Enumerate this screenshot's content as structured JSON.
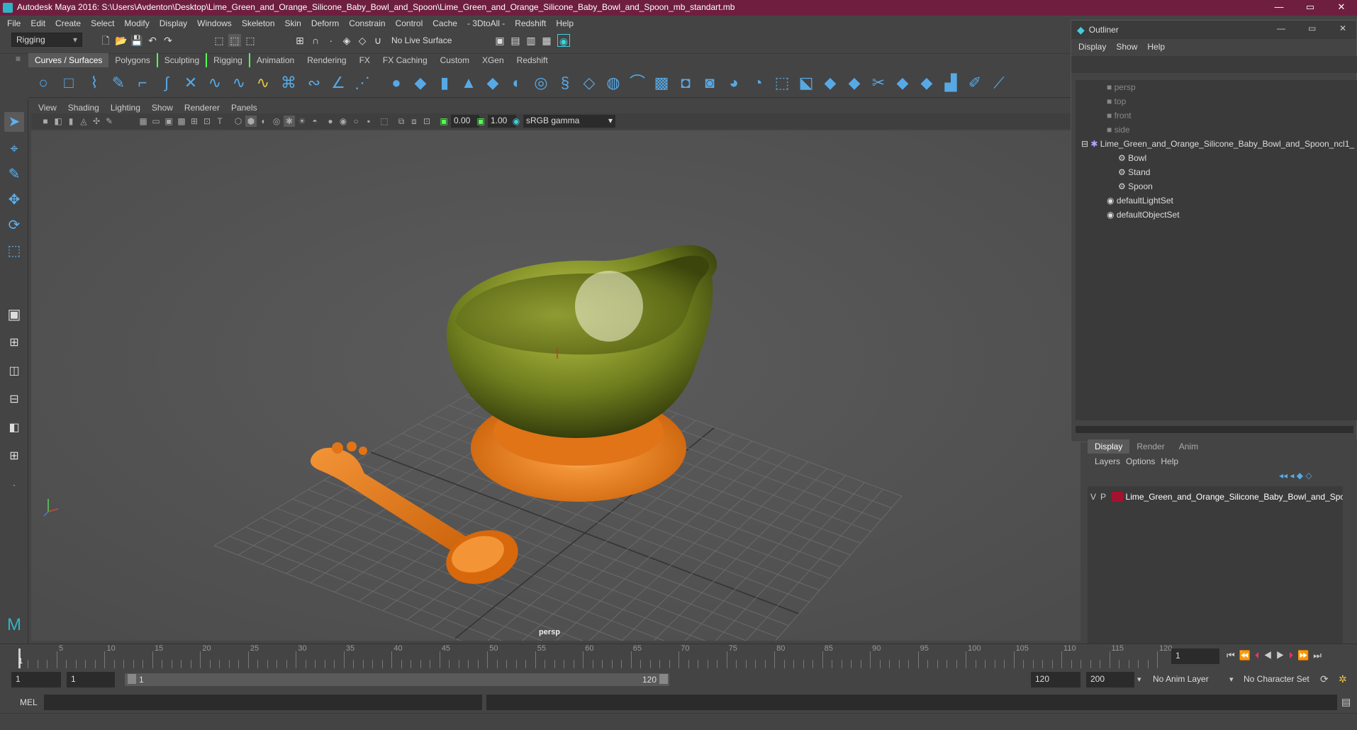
{
  "window": {
    "title": "Autodesk Maya 2016: S:\\Users\\Avdenton\\Desktop\\Lime_Green_and_Orange_Silicone_Baby_Bowl_and_Spoon\\Lime_Green_and_Orange_Silicone_Baby_Bowl_and_Spoon_mb_standart.mb",
    "minimize": "—",
    "maximize": "▭",
    "close": "✕"
  },
  "menubar": [
    "File",
    "Edit",
    "Create",
    "Select",
    "Modify",
    "Display",
    "Windows",
    "Skeleton",
    "Skin",
    "Deform",
    "Constrain",
    "Control",
    "Cache",
    "- 3DtoAll -",
    "Redshift",
    "Help"
  ],
  "statusline": {
    "mode": "Rigging",
    "live_surface": "No Live Surface"
  },
  "shelf_tabs": [
    "Curves / Surfaces",
    "Polygons",
    "Sculpting",
    "Rigging",
    "Animation",
    "Rendering",
    "FX",
    "FX Caching",
    "Custom",
    "XGen",
    "Redshift"
  ],
  "shelf_active": "Curves / Surfaces",
  "panel_menu": [
    "View",
    "Shading",
    "Lighting",
    "Show",
    "Renderer",
    "Panels"
  ],
  "panel_tools": {
    "exposure": "0.00",
    "gamma": "1.00",
    "color_space": "sRGB gamma"
  },
  "viewport": {
    "camera": "persp",
    "bowl_color": "#6e7d1e",
    "orange": "#e07417",
    "grid_color": "#6a6a6a",
    "background": "#555555"
  },
  "outliner": {
    "title": "Outliner",
    "menu": [
      "Display",
      "Show",
      "Help"
    ],
    "items": [
      {
        "label": "persp",
        "dim": true
      },
      {
        "label": "top",
        "dim": true
      },
      {
        "label": "front",
        "dim": true
      },
      {
        "label": "side",
        "dim": true
      },
      {
        "label": "Lime_Green_and_Orange_Silicone_Baby_Bowl_and_Spoon_ncl1_",
        "dim": false
      },
      {
        "label": "Bowl",
        "dim": false
      },
      {
        "label": "Stand",
        "dim": false
      },
      {
        "label": "Spoon",
        "dim": false
      },
      {
        "label": "defaultLightSet",
        "dim": false
      },
      {
        "label": "defaultObjectSet",
        "dim": false
      }
    ]
  },
  "layers": {
    "tabs": [
      "Display",
      "Render",
      "Anim"
    ],
    "menu": [
      "Layers",
      "Options",
      "Help"
    ],
    "row": {
      "v": "V",
      "p": "P",
      "name": "Lime_Green_and_Orange_Silicone_Baby_Bowl_and_Spoo",
      "color": "#a3122f"
    }
  },
  "timeline": {
    "ticks": [
      "5",
      "10",
      "15",
      "20",
      "25",
      "30",
      "35",
      "40",
      "45",
      "50",
      "55",
      "60",
      "65",
      "70",
      "75",
      "80",
      "85",
      "90",
      "95",
      "100",
      "105",
      "110",
      "115",
      "120"
    ],
    "start_label": "1",
    "current_frame": "1"
  },
  "range": {
    "start": "1",
    "playback_start": "1",
    "slider_start": "1",
    "slider_end": "120",
    "playback_end": "120",
    "end": "200",
    "anim_layer": "No Anim Layer",
    "character_set": "No Character Set"
  },
  "cmdline": {
    "label": "MEL"
  }
}
